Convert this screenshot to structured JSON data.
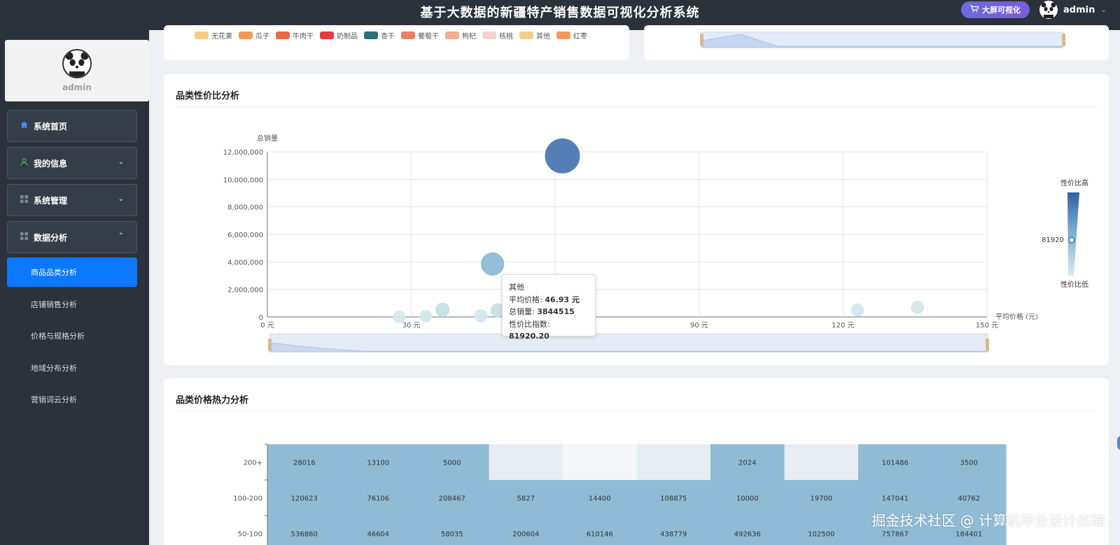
{
  "header": {
    "title": "基于大数据的新疆特产销售数据可视化分析系统",
    "bigscreen_label": "大屏可视化",
    "username": "admin"
  },
  "sidebar": {
    "profile_name": "admin",
    "menu": [
      {
        "label": "系统首页"
      },
      {
        "label": "我的信息"
      },
      {
        "label": "系统管理"
      },
      {
        "label": "数据分析"
      }
    ],
    "submenu": [
      {
        "label": "商品品类分析",
        "active": true
      },
      {
        "label": "店铺销售分析"
      },
      {
        "label": "价格与规格分析"
      },
      {
        "label": "地域分布分析"
      },
      {
        "label": "营销词云分析"
      }
    ]
  },
  "top_legend": [
    {
      "name": "无花果",
      "color": "#f6cd88"
    },
    {
      "name": "瓜子",
      "color": "#f49a57"
    },
    {
      "name": "牛肉干",
      "color": "#ec6a44"
    },
    {
      "name": "奶制品",
      "color": "#e53a3a"
    },
    {
      "name": "杏干",
      "color": "#2e6e78"
    },
    {
      "name": "葡萄干",
      "color": "#ec7f61"
    },
    {
      "name": "枸杞",
      "color": "#f4ab90"
    },
    {
      "name": "核桃",
      "color": "#f6d3ce"
    },
    {
      "name": "其他",
      "color": "#f6cd88"
    },
    {
      "name": "红枣",
      "color": "#f49a57"
    }
  ],
  "scatter_card": {
    "title": "品类性价比分析",
    "visualmap": {
      "high": "性价比高",
      "low": "性价比低",
      "value": "81920"
    },
    "tooltip": {
      "name": "其他",
      "avg_price_label": "平均价格: ",
      "avg_price": "46.93 元",
      "sales_label": "总销量: ",
      "sales": "3844515",
      "index_label": "性价比指数: ",
      "index": "81920.20"
    }
  },
  "heatmap_card": {
    "title": "品类价格热力分析"
  },
  "chart_data": [
    {
      "type": "scatter",
      "title": "品类性价比分析",
      "xlabel": "平均价格 (元)",
      "ylabel": "总销量",
      "xlim": [
        0,
        150
      ],
      "ylim": [
        0,
        12000000
      ],
      "xticks": [
        "0 元",
        "30 元",
        "60 元",
        "90 元",
        "120 元",
        "150 元"
      ],
      "yticks": [
        "0",
        "2,000,000",
        "4,000,000",
        "6,000,000",
        "8,000,000",
        "10,000,000",
        "12,000,000"
      ],
      "points": [
        {
          "x": 61.5,
          "y": 11700000,
          "size": 1.0,
          "color": "#4b78b2"
        },
        {
          "x": 46.93,
          "y": 3844515,
          "size": 0.58,
          "color": "#8cbad6"
        },
        {
          "x": 27.5,
          "y": 0,
          "size": 0.2,
          "color": "#d4e8ec"
        },
        {
          "x": 33,
          "y": 50000,
          "size": 0.2,
          "color": "#d4e8ec"
        },
        {
          "x": 36.5,
          "y": 520000,
          "size": 0.26,
          "color": "#c6e0e6"
        },
        {
          "x": 44.5,
          "y": 80000,
          "size": 0.22,
          "color": "#d4e8ec"
        },
        {
          "x": 48,
          "y": 480000,
          "size": 0.26,
          "color": "#c6e0e6"
        },
        {
          "x": 123,
          "y": 500000,
          "size": 0.22,
          "color": "#d4e8ec"
        },
        {
          "x": 135.5,
          "y": 700000,
          "size": 0.22,
          "color": "#d4e8ec"
        }
      ]
    },
    {
      "type": "heatmap",
      "title": "品类价格热力分析",
      "rows": [
        "200+",
        "100-200",
        "50-100"
      ],
      "values": [
        [
          28016,
          13100,
          5000,
          null,
          null,
          null,
          2024,
          null,
          101486,
          3500
        ],
        [
          120623,
          76106,
          208467,
          5827,
          14400,
          108875,
          10000,
          19700,
          147041,
          40762
        ],
        [
          536860,
          46604,
          58035,
          200604,
          610146,
          438779,
          492636,
          102500,
          757867,
          184401
        ]
      ]
    }
  ],
  "watermark": "掘金技术社区 @ 计算机毕业设计杰瑞"
}
